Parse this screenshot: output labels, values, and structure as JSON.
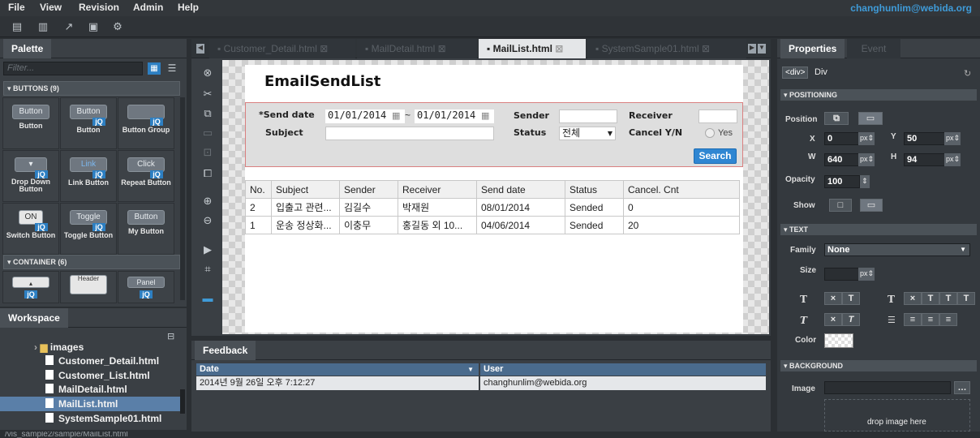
{
  "menu": {
    "file": "File",
    "view": "View",
    "revision": "Revision",
    "admin": "Admin",
    "help": "Help",
    "user": "changhunlim@webida.org"
  },
  "palette": {
    "title": "Palette",
    "filter_placeholder": "Filter...",
    "section_buttons": "BUTTONS (9)",
    "section_container": "CONTAINER (6)",
    "items": [
      {
        "preview": "Button",
        "label": "Button"
      },
      {
        "preview": "Button",
        "label": "Button"
      },
      {
        "preview": "",
        "label": "Button Group"
      },
      {
        "preview": "",
        "label": "Drop Down Button"
      },
      {
        "preview": "Link",
        "label": "Link Button"
      },
      {
        "preview": "Click",
        "label": "Repeat Button"
      },
      {
        "preview": "ON",
        "label": "Switch Button"
      },
      {
        "preview": "Toggle",
        "label": "Toggle Button"
      },
      {
        "preview": "Button",
        "label": "My Button"
      }
    ],
    "containers": [
      {
        "preview": ""
      },
      {
        "preview": "Header"
      },
      {
        "preview": "Panel"
      }
    ],
    "jq": "jQ"
  },
  "workspace": {
    "title": "Workspace",
    "folder": "images",
    "files": [
      "Customer_Detail.html",
      "Customer_List.html",
      "MailDetail.html",
      "MailList.html",
      "SystemSample01.html"
    ]
  },
  "tabs": [
    "Customer_Detail.html",
    "MailDetail.html",
    "MailList.html",
    "SystemSample01.html"
  ],
  "page": {
    "title": "EmailSendList",
    "form": {
      "send_date_label": "*Send date",
      "date_from": "01/01/2014",
      "tilde": "~",
      "date_to": "01/01/2014",
      "sender_label": "Sender",
      "receiver_label": "Receiver",
      "subject_label": "Subject",
      "status_label": "Status",
      "status_value": "전체",
      "cancel_label": "Cancel Y/N",
      "yes_label": "Yes",
      "search": "Search"
    },
    "grid": {
      "headers": [
        "No.",
        "Subject",
        "Sender",
        "Receiver",
        "Send date",
        "Status",
        "Cancel. Cnt"
      ],
      "rows": [
        [
          "2",
          "입출고 관련...",
          "김길수",
          "박재원",
          "08/01/2014",
          "Sended",
          "0"
        ],
        [
          "1",
          "운송 정상화...",
          "이충무",
          "홍길동 외 10...",
          "04/06/2014",
          "Sended",
          "20"
        ]
      ]
    }
  },
  "feedback": {
    "title": "Feedback",
    "col_date": "Date",
    "col_user": "User",
    "row_date": "2014년 9월 26일 오후 7:12:27",
    "row_user": "changhunlim@webida.org"
  },
  "properties": {
    "tab_props": "Properties",
    "tab_event": "Event",
    "element": "<div>",
    "element_type": "Div",
    "positioning": "POSITIONING",
    "position": "Position",
    "x_label": "X",
    "x": "0",
    "y_label": "Y",
    "y": "50",
    "w_label": "W",
    "w": "640",
    "h_label": "H",
    "h": "94",
    "unit": "px",
    "opacity_label": "Opacity",
    "opacity": "100",
    "show_label": "Show",
    "text": "TEXT",
    "family_label": "Family",
    "family": "None",
    "size_label": "Size",
    "color_label": "Color",
    "background": "BACKGROUND",
    "image_label": "Image",
    "drop": "drop image here"
  },
  "status": "/vis_sample2/sample/MailList.html"
}
